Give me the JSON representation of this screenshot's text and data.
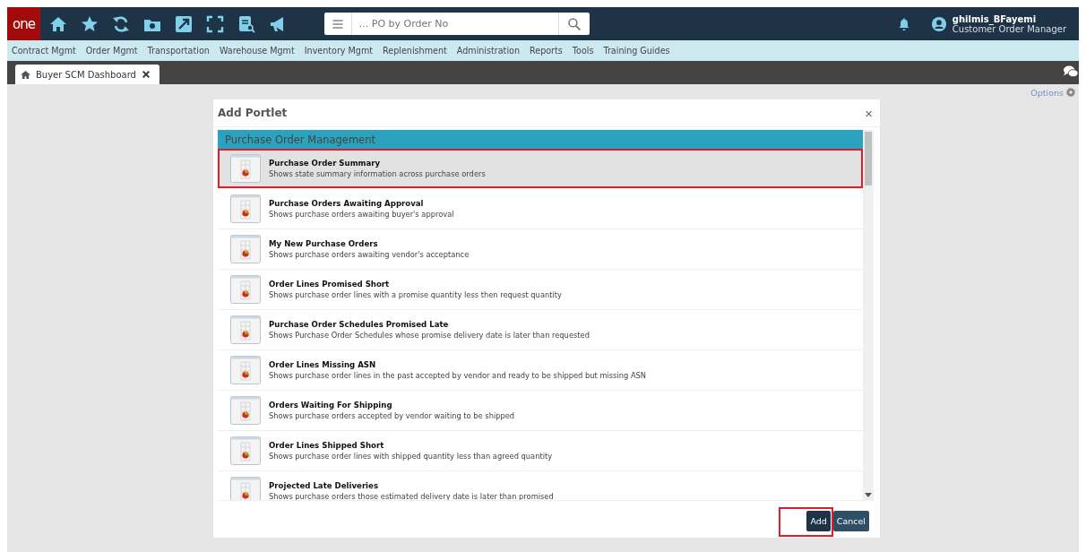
{
  "topbar": {
    "logo": "one",
    "search": {
      "placeholder": "... PO by Order No"
    },
    "user": {
      "name": "ghilmis_BFayemi",
      "role": "Customer Order Manager"
    }
  },
  "menu": [
    "Contract Mgmt",
    "Order Mgmt",
    "Transportation",
    "Warehouse Mgmt",
    "Inventory Mgmt",
    "Replenishment",
    "Administration",
    "Reports",
    "Tools",
    "Training Guides"
  ],
  "tabs": [
    {
      "label": "Buyer SCM Dashboard",
      "selected": true
    }
  ],
  "options": "Options",
  "dialog": {
    "title": "Add Portlet",
    "close": "×",
    "group": "Purchase Order Management",
    "items": [
      {
        "title": "Purchase Order Summary",
        "description": "Shows state summary information across purchase orders",
        "selected": true
      },
      {
        "title": "Purchase Orders Awaiting Approval",
        "description": "Shows purchase orders awaiting buyer's approval",
        "selected": false
      },
      {
        "title": "My New Purchase Orders",
        "description": "Shows purchase orders awaiting vendor's acceptance",
        "selected": false
      },
      {
        "title": "Order Lines Promised Short",
        "description": "Shows purchase order lines with a promise quantity less then request quantity",
        "selected": false
      },
      {
        "title": "Purchase Order Schedules Promised Late",
        "description": "Shows Purchase Order Schedules whose promise delivery date is later than requested",
        "selected": false
      },
      {
        "title": "Order Lines Missing ASN",
        "description": "Shows purchase order lines in the past accepted by vendor and ready to be shipped but missing ASN",
        "selected": false
      },
      {
        "title": "Orders Waiting For Shipping",
        "description": "Shows purchase orders accepted by vendor waiting to be shipped",
        "selected": false
      },
      {
        "title": "Order Lines Shipped Short",
        "description": "Shows purchase order lines with shipped quantity less than agreed quantity",
        "selected": false
      },
      {
        "title": "Projected Late Deliveries",
        "description": "Shows purchase orders those estimated delivery date is later than promised",
        "selected": false
      }
    ],
    "buttons": [
      {
        "label": "Add",
        "kind": "primary",
        "highlighted": true
      },
      {
        "label": "Cancel",
        "kind": "secondary",
        "highlighted": false
      }
    ]
  }
}
